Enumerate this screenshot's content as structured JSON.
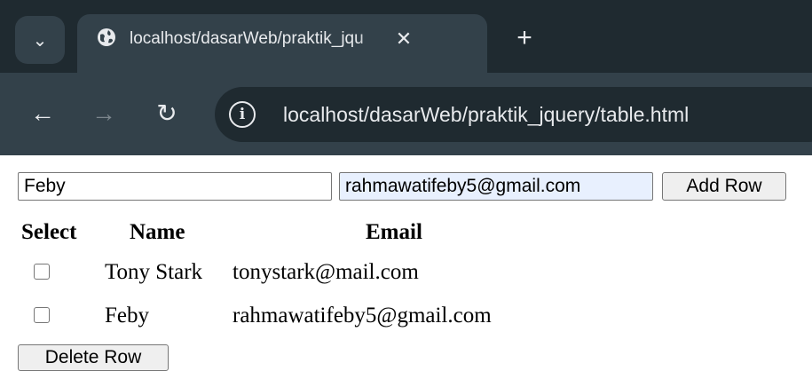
{
  "browser": {
    "tab": {
      "title": "localhost/dasarWeb/praktik_jqu",
      "close_glyph": "✕",
      "icon": "globe-icon"
    },
    "tab_menu_glyph": "⌄",
    "new_tab_glyph": "+",
    "nav": {
      "back_glyph": "←",
      "forward_glyph": "→",
      "reload_glyph": "↻"
    },
    "url": "localhost/dasarWeb/praktik_jquery/table.html",
    "info_glyph": "i"
  },
  "form": {
    "name_value": "Feby",
    "email_value": "rahmawatifeby5@gmail.com",
    "add_label": "Add Row"
  },
  "table": {
    "headers": {
      "select": "Select",
      "name": "Name",
      "email": "Email"
    },
    "rows": [
      {
        "name": "Tony Stark",
        "email": "tonystark@mail.com",
        "checked": false
      },
      {
        "name": "Feby",
        "email": "rahmawatifeby5@gmail.com",
        "checked": false
      }
    ]
  },
  "delete_label": "Delete Row"
}
